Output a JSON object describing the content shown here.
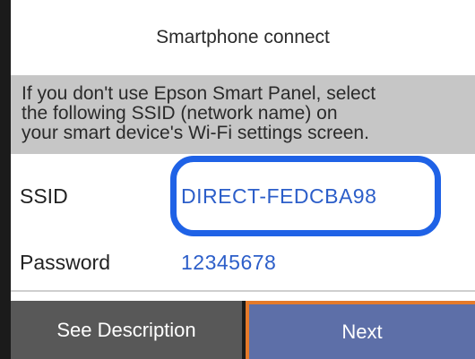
{
  "title": "Smartphone connect",
  "instruction": "If you don't use Epson Smart Panel, select\nthe following SSID (network name) on\nyour smart device's Wi-Fi settings screen.",
  "ssid": {
    "label": "SSID",
    "value": "DIRECT-FEDCBA98"
  },
  "password": {
    "label": "Password",
    "value": "12345678"
  },
  "buttons": {
    "see_description": "See Description",
    "next": "Next"
  },
  "colors": {
    "value_text": "#2c5ec9",
    "highlight_ring": "#1f62e6",
    "next_button": "#5d6fa8",
    "focus_outline": "#e57a2a",
    "info_background": "#c6c6c6"
  }
}
